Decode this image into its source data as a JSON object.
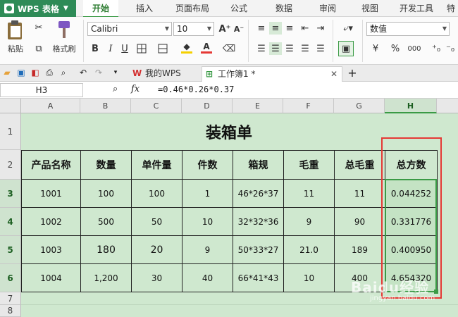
{
  "app": {
    "title": "WPS 表格"
  },
  "menu": {
    "tabs": [
      "开始",
      "插入",
      "页面布局",
      "公式",
      "数据",
      "审阅",
      "视图",
      "开发工具",
      "特"
    ],
    "active": "开始"
  },
  "ribbon": {
    "paste_label": "粘贴",
    "format_painter_label": "格式刷",
    "font_name": "Calibri",
    "font_size": "10",
    "number_format": "数值",
    "percent_symbol": "%",
    "grow_font": "A⁺",
    "shrink_font": "A⁻",
    "bold": "B",
    "italic": "I",
    "underline": "U",
    "font_color_letter": "A",
    "thousands_symbol": "000",
    "colors": {
      "font_color": "#e53935",
      "fill_color": "#f5d000",
      "accent": "#3a9a45"
    }
  },
  "doc_tabs": [
    {
      "label": "我的WPS"
    },
    {
      "label": "工作簿1 *"
    }
  ],
  "formula_bar": {
    "cell_ref": "H3",
    "fx": "fx",
    "formula": "=0.46*0.26*0.37"
  },
  "sheet": {
    "columns": [
      "A",
      "B",
      "C",
      "D",
      "E",
      "F",
      "G",
      "H"
    ],
    "rows": [
      "1",
      "2",
      "3",
      "4",
      "5",
      "6",
      "7",
      "8"
    ],
    "selected_column": "H",
    "selected_rows": [
      "3",
      "4",
      "5",
      "6"
    ],
    "title": "装箱单",
    "headers": [
      "产品名称",
      "数量",
      "单件量",
      "件数",
      "箱规",
      "毛重",
      "总毛重",
      "总方数"
    ],
    "data": [
      [
        "1001",
        "100",
        "100",
        "1",
        "46*26*37",
        "11",
        "11",
        "0.044252"
      ],
      [
        "1002",
        "500",
        "50",
        "10",
        "32*32*36",
        "9",
        "90",
        "0.331776"
      ],
      [
        "1003",
        "180",
        "20",
        "9",
        "50*33*27",
        "21.0",
        "189",
        "0.400950"
      ],
      [
        "1004",
        "1,200",
        "30",
        "40",
        "66*41*43",
        "10",
        "400",
        "4.654320"
      ]
    ]
  },
  "watermark": {
    "main": "Baidu经验",
    "sub": "jingyan.baidu.com"
  }
}
